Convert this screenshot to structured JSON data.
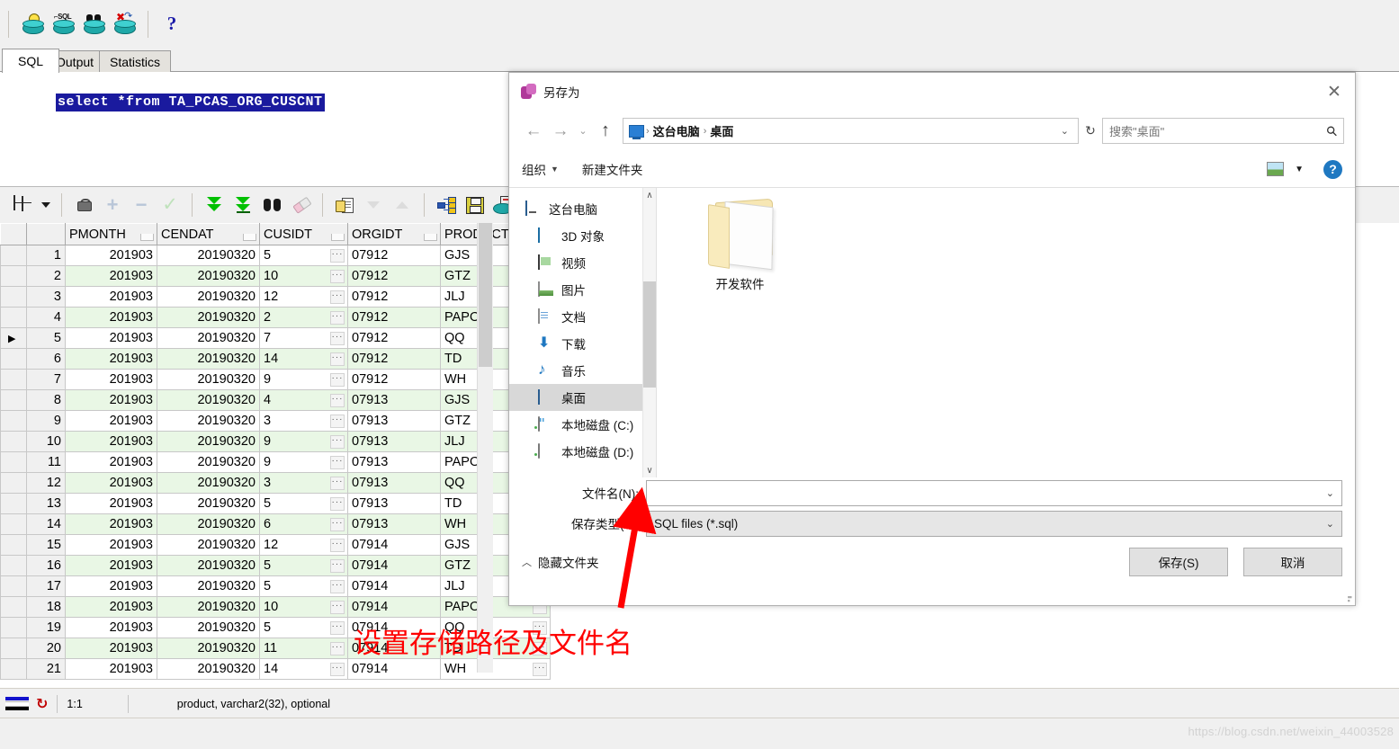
{
  "app": {
    "toolbar": [
      {
        "name": "explain-plan",
        "icon": "db-bulb-icon"
      },
      {
        "name": "sql-window",
        "icon": "db-sql-icon"
      },
      {
        "name": "find-db-objects",
        "icon": "db-binoculars-icon"
      },
      {
        "name": "rollback",
        "icon": "db-rollback-icon"
      },
      {
        "name": "help",
        "icon": "question-mark-icon",
        "label": "?"
      }
    ],
    "tabs": [
      {
        "label": "SQL",
        "active": true
      },
      {
        "label": "Output",
        "active": false
      },
      {
        "label": "Statistics",
        "active": false
      }
    ],
    "editor": {
      "sql_text": "select *from TA_PCAS_ORG_CUSCNT"
    },
    "grid_toolbar": [
      {
        "name": "grid-layout",
        "icon": "grid-icon"
      },
      {
        "name": "grid-layout-dropdown",
        "icon": "chevron-down-icon"
      },
      {
        "name": "lock-record",
        "icon": "lock-icon"
      },
      {
        "name": "insert-record",
        "icon": "plus-icon"
      },
      {
        "name": "delete-record",
        "icon": "minus-icon"
      },
      {
        "name": "post-changes",
        "icon": "check-icon"
      },
      {
        "name": "fetch-next-page",
        "icon": "double-arrow-down-icon"
      },
      {
        "name": "fetch-last-page",
        "icon": "double-arrow-down-bar-icon"
      },
      {
        "name": "find-in-grid",
        "icon": "binoculars-icon"
      },
      {
        "name": "clear-filter",
        "icon": "eraser-icon"
      },
      {
        "name": "copy-to-clipboard",
        "icon": "copy-icon"
      },
      {
        "name": "sort-descending",
        "icon": "triangle-down-icon"
      },
      {
        "name": "sort-ascending",
        "icon": "triangle-up-icon"
      },
      {
        "name": "flow-chart",
        "icon": "network-icon"
      },
      {
        "name": "save-results",
        "icon": "floppy-disk-icon"
      },
      {
        "name": "export-data",
        "icon": "export-db-icon"
      }
    ],
    "statusbar": {
      "position": "1:1",
      "field_info": "product, varchar2(32), optional"
    },
    "watermark": "https://blog.csdn.net/weixin_44003528"
  },
  "grid": {
    "columns": [
      "PMONTH",
      "CENDAT",
      "CUSIDT",
      "ORGIDT",
      "PRODUCT"
    ],
    "current_row": 5,
    "rows": [
      {
        "n": 1,
        "PMONTH": "201903",
        "CENDAT": "20190320",
        "CUSIDT": "5",
        "ORGIDT": "07912",
        "PRODUCT": "GJS"
      },
      {
        "n": 2,
        "PMONTH": "201903",
        "CENDAT": "20190320",
        "CUSIDT": "10",
        "ORGIDT": "07912",
        "PRODUCT": "GTZ"
      },
      {
        "n": 3,
        "PMONTH": "201903",
        "CENDAT": "20190320",
        "CUSIDT": "12",
        "ORGIDT": "07912",
        "PRODUCT": "JLJ"
      },
      {
        "n": 4,
        "PMONTH": "201903",
        "CENDAT": "20190320",
        "CUSIDT": "2",
        "ORGIDT": "07912",
        "PRODUCT": "PAPOIL"
      },
      {
        "n": 5,
        "PMONTH": "201903",
        "CENDAT": "20190320",
        "CUSIDT": "7",
        "ORGIDT": "07912",
        "PRODUCT": "QQ"
      },
      {
        "n": 6,
        "PMONTH": "201903",
        "CENDAT": "20190320",
        "CUSIDT": "14",
        "ORGIDT": "07912",
        "PRODUCT": "TD"
      },
      {
        "n": 7,
        "PMONTH": "201903",
        "CENDAT": "20190320",
        "CUSIDT": "9",
        "ORGIDT": "07912",
        "PRODUCT": "WH"
      },
      {
        "n": 8,
        "PMONTH": "201903",
        "CENDAT": "20190320",
        "CUSIDT": "4",
        "ORGIDT": "07913",
        "PRODUCT": "GJS"
      },
      {
        "n": 9,
        "PMONTH": "201903",
        "CENDAT": "20190320",
        "CUSIDT": "3",
        "ORGIDT": "07913",
        "PRODUCT": "GTZ"
      },
      {
        "n": 10,
        "PMONTH": "201903",
        "CENDAT": "20190320",
        "CUSIDT": "9",
        "ORGIDT": "07913",
        "PRODUCT": "JLJ"
      },
      {
        "n": 11,
        "PMONTH": "201903",
        "CENDAT": "20190320",
        "CUSIDT": "9",
        "ORGIDT": "07913",
        "PRODUCT": "PAPOIL"
      },
      {
        "n": 12,
        "PMONTH": "201903",
        "CENDAT": "20190320",
        "CUSIDT": "3",
        "ORGIDT": "07913",
        "PRODUCT": "QQ"
      },
      {
        "n": 13,
        "PMONTH": "201903",
        "CENDAT": "20190320",
        "CUSIDT": "5",
        "ORGIDT": "07913",
        "PRODUCT": "TD"
      },
      {
        "n": 14,
        "PMONTH": "201903",
        "CENDAT": "20190320",
        "CUSIDT": "6",
        "ORGIDT": "07913",
        "PRODUCT": "WH"
      },
      {
        "n": 15,
        "PMONTH": "201903",
        "CENDAT": "20190320",
        "CUSIDT": "12",
        "ORGIDT": "07914",
        "PRODUCT": "GJS"
      },
      {
        "n": 16,
        "PMONTH": "201903",
        "CENDAT": "20190320",
        "CUSIDT": "5",
        "ORGIDT": "07914",
        "PRODUCT": "GTZ"
      },
      {
        "n": 17,
        "PMONTH": "201903",
        "CENDAT": "20190320",
        "CUSIDT": "5",
        "ORGIDT": "07914",
        "PRODUCT": "JLJ"
      },
      {
        "n": 18,
        "PMONTH": "201903",
        "CENDAT": "20190320",
        "CUSIDT": "10",
        "ORGIDT": "07914",
        "PRODUCT": "PAPOIL"
      },
      {
        "n": 19,
        "PMONTH": "201903",
        "CENDAT": "20190320",
        "CUSIDT": "5",
        "ORGIDT": "07914",
        "PRODUCT": "QQ"
      },
      {
        "n": 20,
        "PMONTH": "201903",
        "CENDAT": "20190320",
        "CUSIDT": "11",
        "ORGIDT": "07914",
        "PRODUCT": "TD"
      },
      {
        "n": 21,
        "PMONTH": "201903",
        "CENDAT": "20190320",
        "CUSIDT": "14",
        "ORGIDT": "07914",
        "PRODUCT": "WH"
      }
    ]
  },
  "dialog": {
    "title": "另存为",
    "close_label": "✕",
    "nav": {
      "back": "←",
      "forward": "→",
      "recent": "⌄",
      "up": "↑",
      "breadcrumbs": [
        "这台电脑",
        "桌面"
      ],
      "crumb_sep": "›",
      "address_caret": "⌄",
      "refresh": "↻",
      "search_placeholder": "搜索\"桌面\"",
      "search_icon": "⚲"
    },
    "commands": {
      "organize": "组织",
      "organize_caret": "▼",
      "new_folder": "新建文件夹",
      "view_caret": "▼",
      "help": "?"
    },
    "sidebar": [
      {
        "label": "这台电脑",
        "icon": "pc-icon",
        "level": "root",
        "state": "normal"
      },
      {
        "label": "3D 对象",
        "icon": "3d-objects-icon",
        "level": "child",
        "state": "normal"
      },
      {
        "label": "视频",
        "icon": "videos-icon",
        "level": "child",
        "state": "normal"
      },
      {
        "label": "图片",
        "icon": "pictures-icon",
        "level": "child",
        "state": "normal"
      },
      {
        "label": "文档",
        "icon": "documents-icon",
        "level": "child",
        "state": "normal"
      },
      {
        "label": "下载",
        "icon": "downloads-icon",
        "level": "child",
        "state": "normal"
      },
      {
        "label": "音乐",
        "icon": "music-icon",
        "level": "child",
        "state": "normal"
      },
      {
        "label": "桌面",
        "icon": "desktop-icon",
        "level": "child",
        "state": "selected"
      },
      {
        "label": "本地磁盘 (C:)",
        "icon": "drive-c-icon",
        "level": "child",
        "state": "normal"
      },
      {
        "label": "本地磁盘 (D:)",
        "icon": "drive-d-icon",
        "level": "child",
        "state": "normal"
      }
    ],
    "files": [
      {
        "name": "开发软件",
        "icon": "folder-icon"
      }
    ],
    "fields": {
      "filename_label": "文件名(N):",
      "filename_value": "",
      "filetype_label": "保存类型(T):",
      "filetype_value": "SQL files (*.sql)",
      "combo_caret": "⌄"
    },
    "footer": {
      "hide_folders": "隐藏文件夹",
      "hide_folders_caret": "︿",
      "save": "保存(S)",
      "cancel": "取消"
    }
  },
  "annotation": {
    "text": "设置存储路径及文件名",
    "color": "#ff0000"
  }
}
